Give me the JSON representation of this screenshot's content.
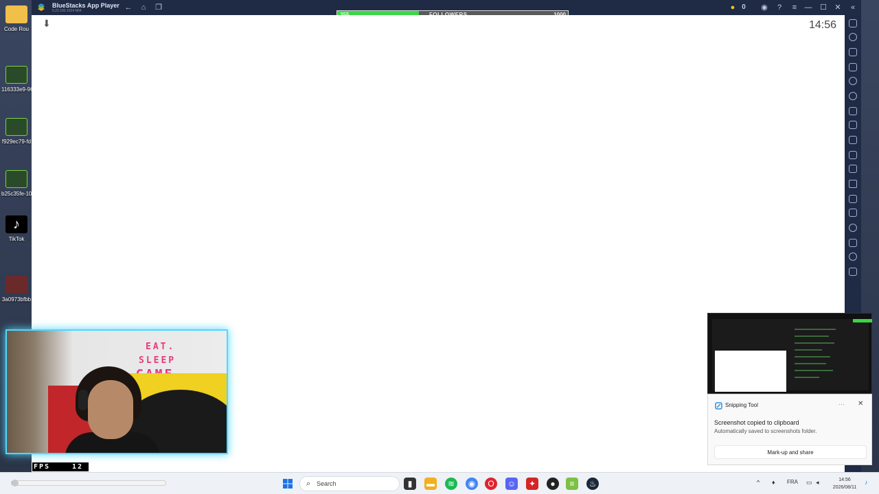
{
  "desktop": {
    "icons": [
      {
        "label": "Code Rou",
        "color": "#f0c04a"
      },
      {
        "label": "116333e9-96",
        "color": "#2a4a2a"
      },
      {
        "label": "f929ec79-fd",
        "color": "#2a4a2a"
      },
      {
        "label": "b25c35fe-10",
        "color": "#2a4a2a"
      },
      {
        "label": "TikTok",
        "color": "#000000"
      },
      {
        "label": "3a0973bfbb",
        "color": "#6a2a2a"
      }
    ]
  },
  "bluestacks": {
    "title": "BlueStacks App Player",
    "version": "5.22.100.1024  N64",
    "clock": "14:56",
    "coins": "0"
  },
  "followers_bar": {
    "current": "355",
    "label": "FOLLOWERS",
    "goal": "1000",
    "progress": 0.355,
    "fill_color": "#3bd644"
  },
  "webcam": {
    "shirt_text": [
      "EAT.",
      "SLEEP",
      "GAME"
    ],
    "frame_color": "#4fd8ff"
  },
  "fps": {
    "label": "FPS",
    "value": "12"
  },
  "toast": {
    "app": "Snipping Tool",
    "more": "···",
    "title": "Screenshot copied to clipboard",
    "body": "Automatically saved to screenshots folder.",
    "button": "Mark-up and share"
  },
  "taskbar": {
    "search_placeholder": "Search",
    "language": "FRA",
    "time": "14:56",
    "date": "2026/08/11",
    "apps": [
      {
        "name": "windows-start",
        "color": "#1a73e8"
      },
      {
        "name": "task-view",
        "color": "#333333"
      },
      {
        "name": "file-explorer",
        "color": "#f2b01e"
      },
      {
        "name": "spotify",
        "color": "#1db954"
      },
      {
        "name": "chrome",
        "color": "#4285f4"
      },
      {
        "name": "opera",
        "color": "#e0222f"
      },
      {
        "name": "discord",
        "color": "#5865f2"
      },
      {
        "name": "app-red",
        "color": "#d42626"
      },
      {
        "name": "app-dark",
        "color": "#222222"
      },
      {
        "name": "bluestacks",
        "color": "#7bc142"
      },
      {
        "name": "steam",
        "color": "#1b2838"
      }
    ]
  }
}
